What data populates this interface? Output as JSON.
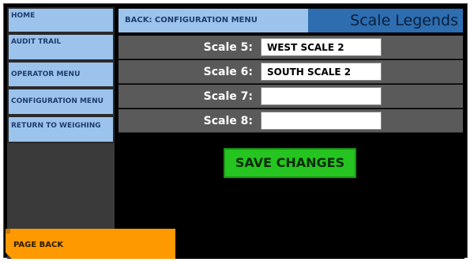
{
  "sidebar": {
    "items": [
      {
        "label": "HOME"
      },
      {
        "label": "AUDIT TRAIL"
      },
      {
        "label": "OPERATOR MENU"
      },
      {
        "label": "CONFIGURATION MENU"
      },
      {
        "label": "RETURN TO WEIGHING"
      }
    ]
  },
  "header": {
    "back_label": "BACK: CONFIGURATION MENU",
    "title": "Scale Legends"
  },
  "scales": [
    {
      "label": "Scale 5:",
      "value": "WEST SCALE 2"
    },
    {
      "label": "Scale 6:",
      "value": "SOUTH SCALE 2"
    },
    {
      "label": "Scale 7:",
      "value": ""
    },
    {
      "label": "Scale 8:",
      "value": ""
    }
  ],
  "actions": {
    "save_label": "SAVE CHANGES",
    "page_back_label": "PAGE BACK"
  },
  "colors": {
    "nav": "#9cc3ec",
    "title_bar": "#2d6db0",
    "save": "#26c420",
    "page_back": "#ff9900"
  }
}
